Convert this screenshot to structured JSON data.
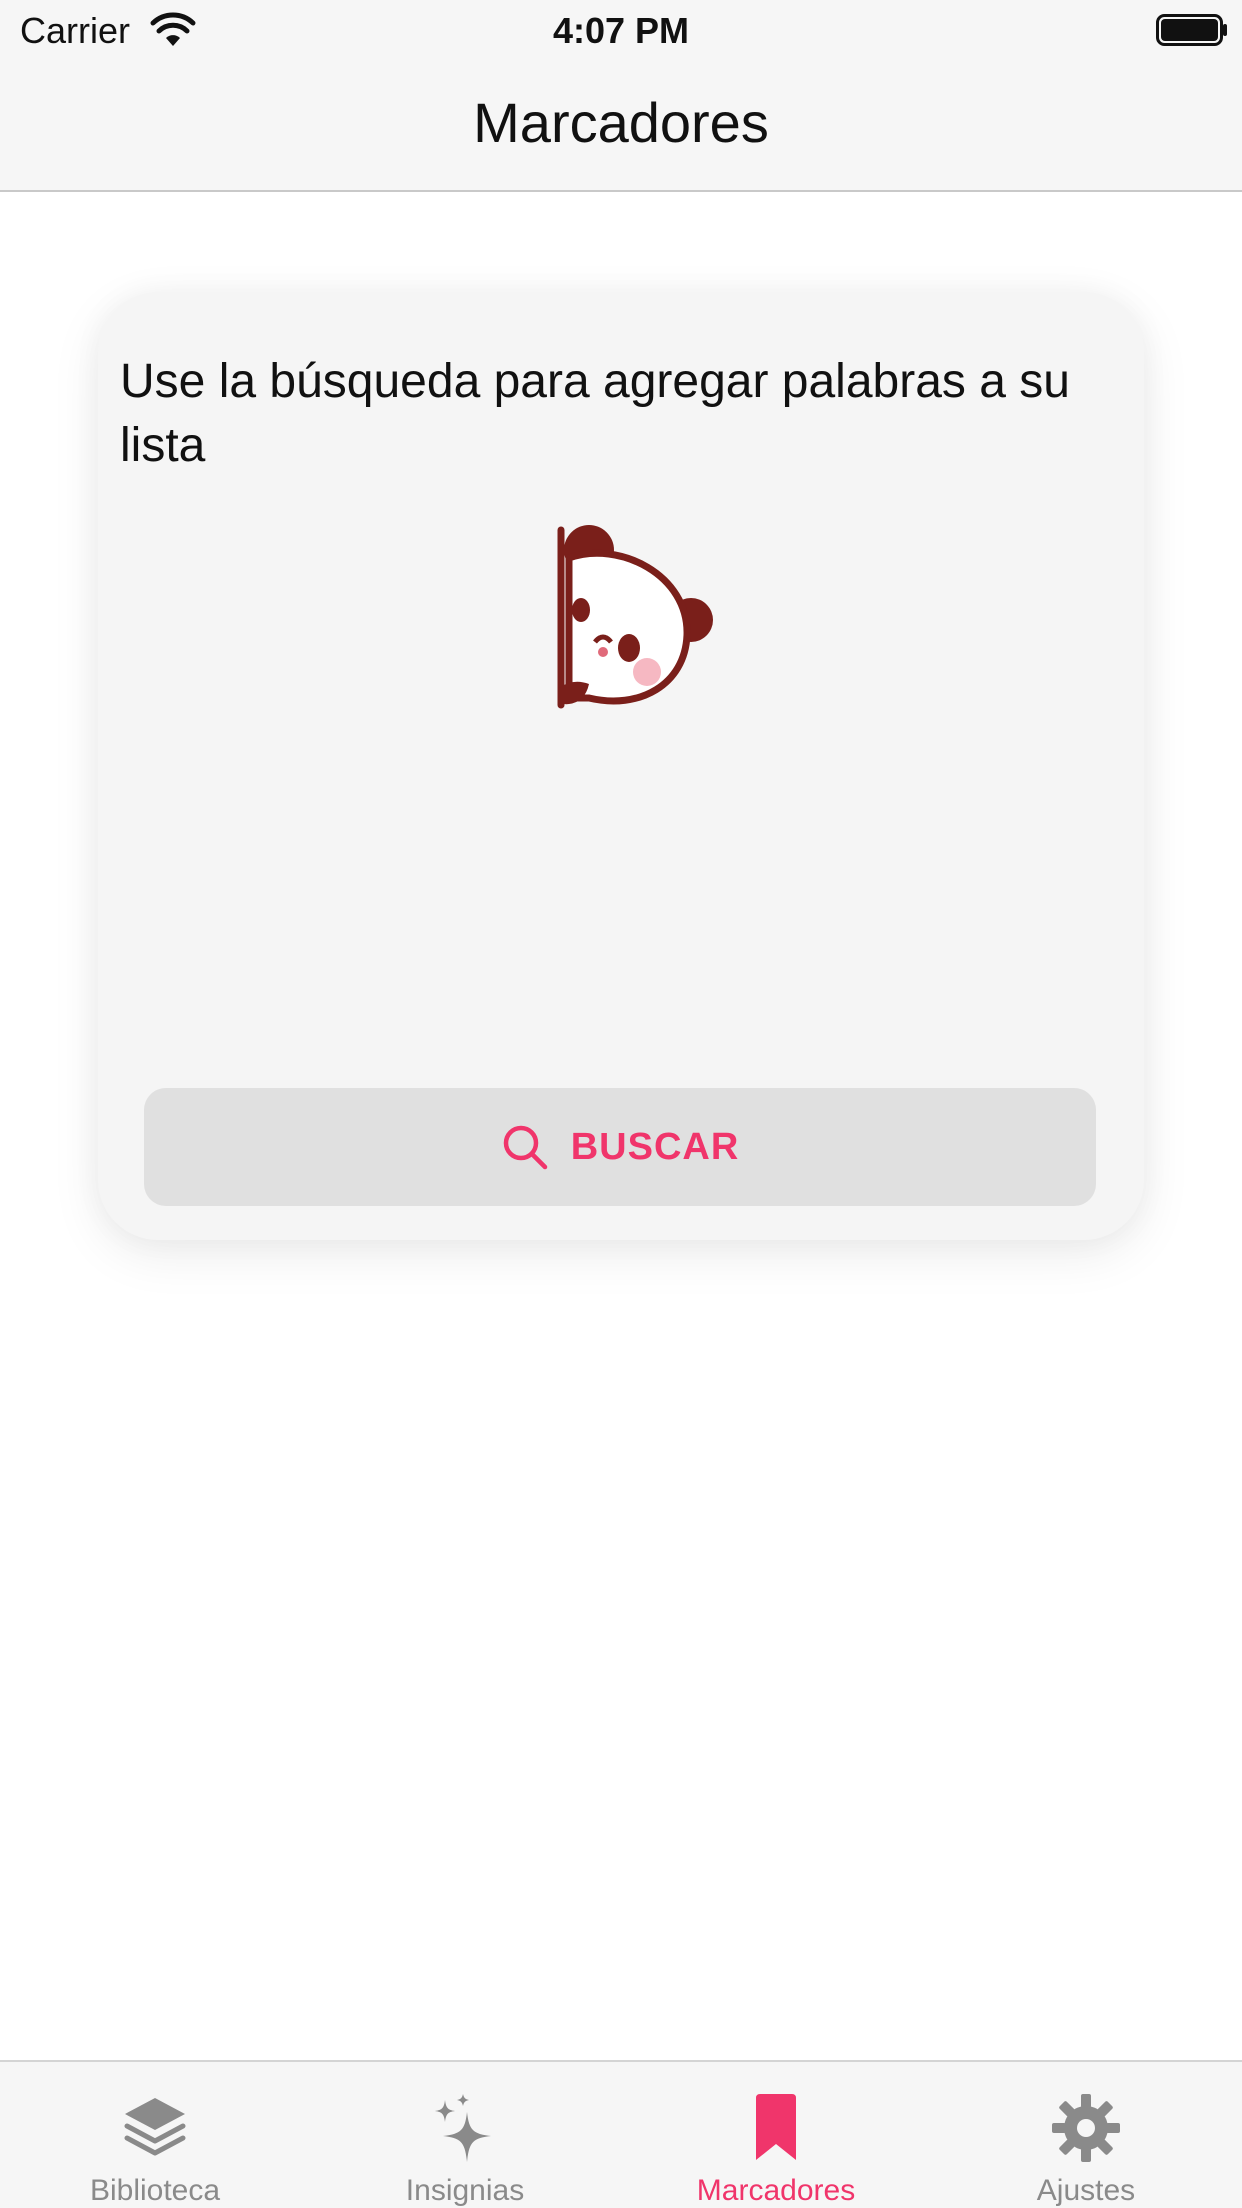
{
  "status_bar": {
    "carrier": "Carrier",
    "time": "4:07 PM"
  },
  "nav": {
    "title": "Marcadores"
  },
  "card": {
    "message": "Use la búsqueda para agregar palabras a su lista",
    "illustration": "peeking-panda",
    "search_button_label": "BUSCAR",
    "search_icon": "search-icon"
  },
  "tabs": [
    {
      "label": "Biblioteca",
      "icon": "layers-icon",
      "active": false
    },
    {
      "label": "Insignias",
      "icon": "sparkles-icon",
      "active": false
    },
    {
      "label": "Marcadores",
      "icon": "bookmark-icon",
      "active": true
    },
    {
      "label": "Ajustes",
      "icon": "gear-icon",
      "active": false
    }
  ],
  "colors": {
    "accent": "#f0356b",
    "bar_background": "#f6f6f6",
    "card_background": "#f5f5f5",
    "button_background": "#e0e0e0",
    "inactive_tab": "#8a8a8a",
    "panda_outline": "#7a1f1a"
  }
}
